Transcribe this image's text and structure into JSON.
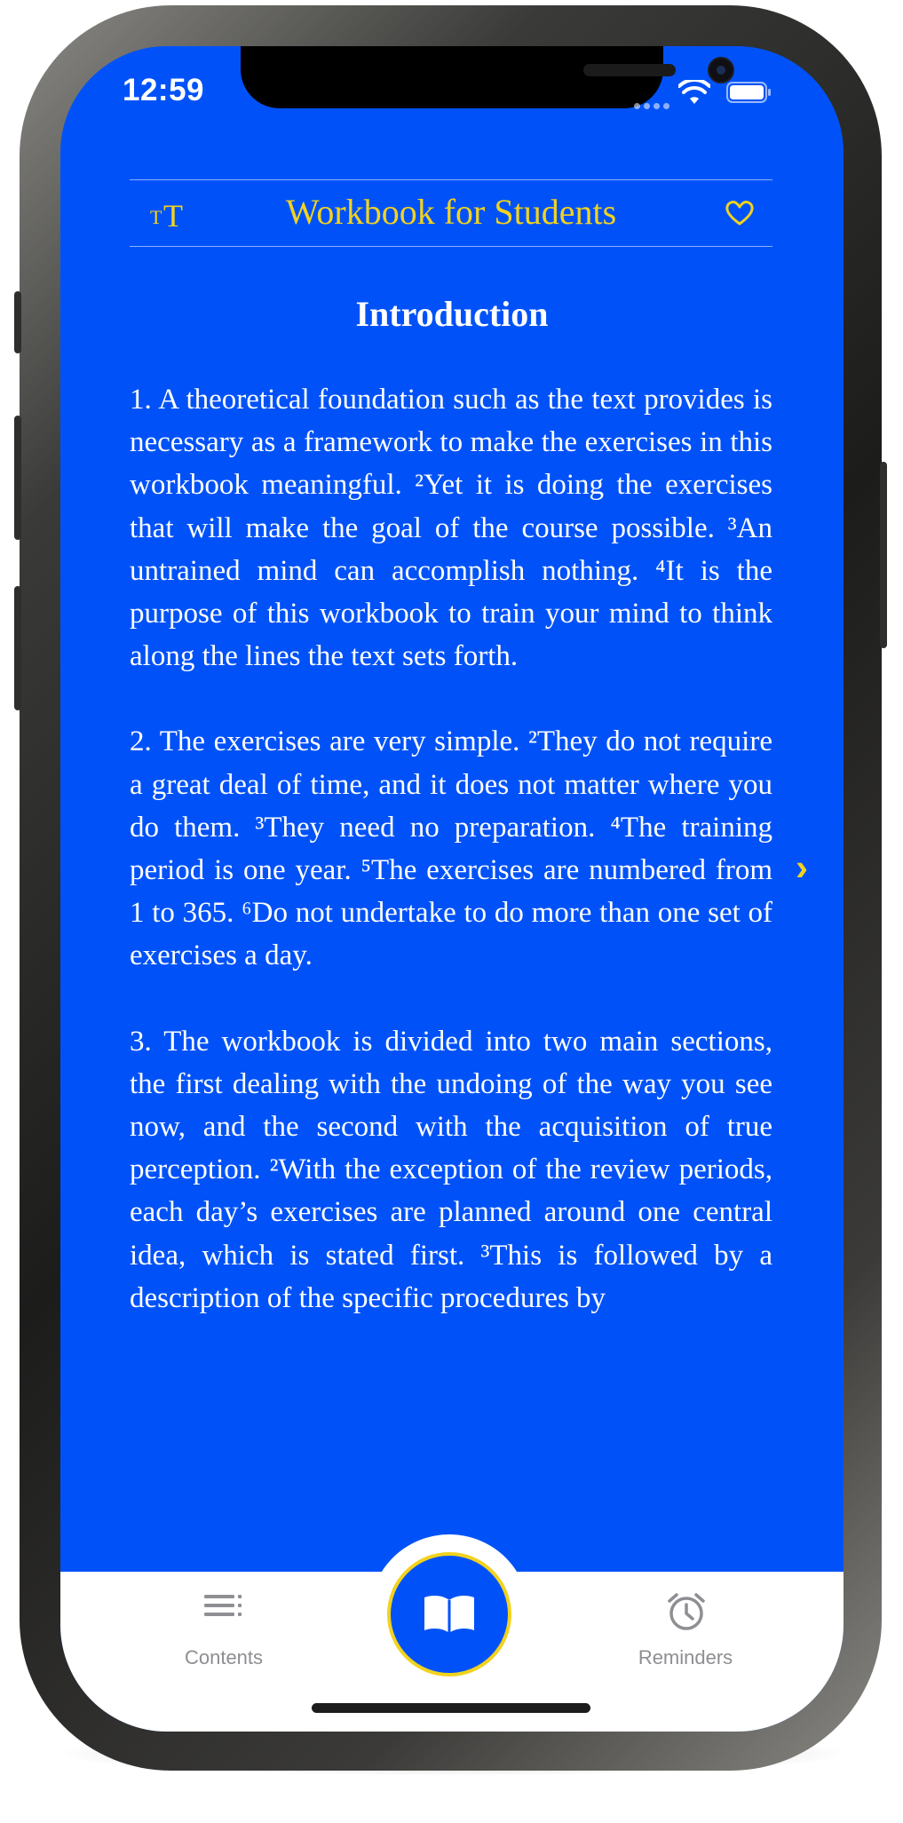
{
  "status_bar": {
    "time": "12:59"
  },
  "header": {
    "title": "Workbook for Students",
    "font_size_small": "T",
    "font_size_large": "T"
  },
  "content": {
    "section_title": "Introduction",
    "paragraphs": [
      "1. A theoretical foundation such as the text provides is necessary as a framework to make the exercises in this workbook meaningful. ²Yet it is doing the exercises that will make the goal of the course possible. ³An untrained mind can accomplish nothing. ⁴It is the purpose of this workbook to train your mind to think along the lines the text sets forth.",
      "2. The exercises are very simple. ²They do not require a great deal of time, and it does not matter where you do them. ³They need no preparation. ⁴The training period is one year. ⁵The exercises are numbered from 1 to 365. ⁶Do not undertake to do more than one set of exercises a day.",
      "3. The workbook is divided into two main sections, the first dealing with the undoing of the way you see now, and the second with the acquisition of true perception. ²With the exception of the review periods, each day’s exercises are planned around one central idea, which is stated first. ³This is followed by a description of the specific procedures by"
    ],
    "next_arrow": "›"
  },
  "tab_bar": {
    "contents_label": "Contents",
    "reminders_label": "Reminders"
  },
  "colors": {
    "background": "#0052F8",
    "accent": "#F2D21E",
    "text": "#FFFFFF",
    "tab_label": "#8E8E93"
  },
  "icons": {
    "font_size": "text-size-icon",
    "favorite": "heart-icon",
    "contents": "list-icon",
    "read": "book-icon",
    "reminders": "alarm-clock-icon"
  }
}
